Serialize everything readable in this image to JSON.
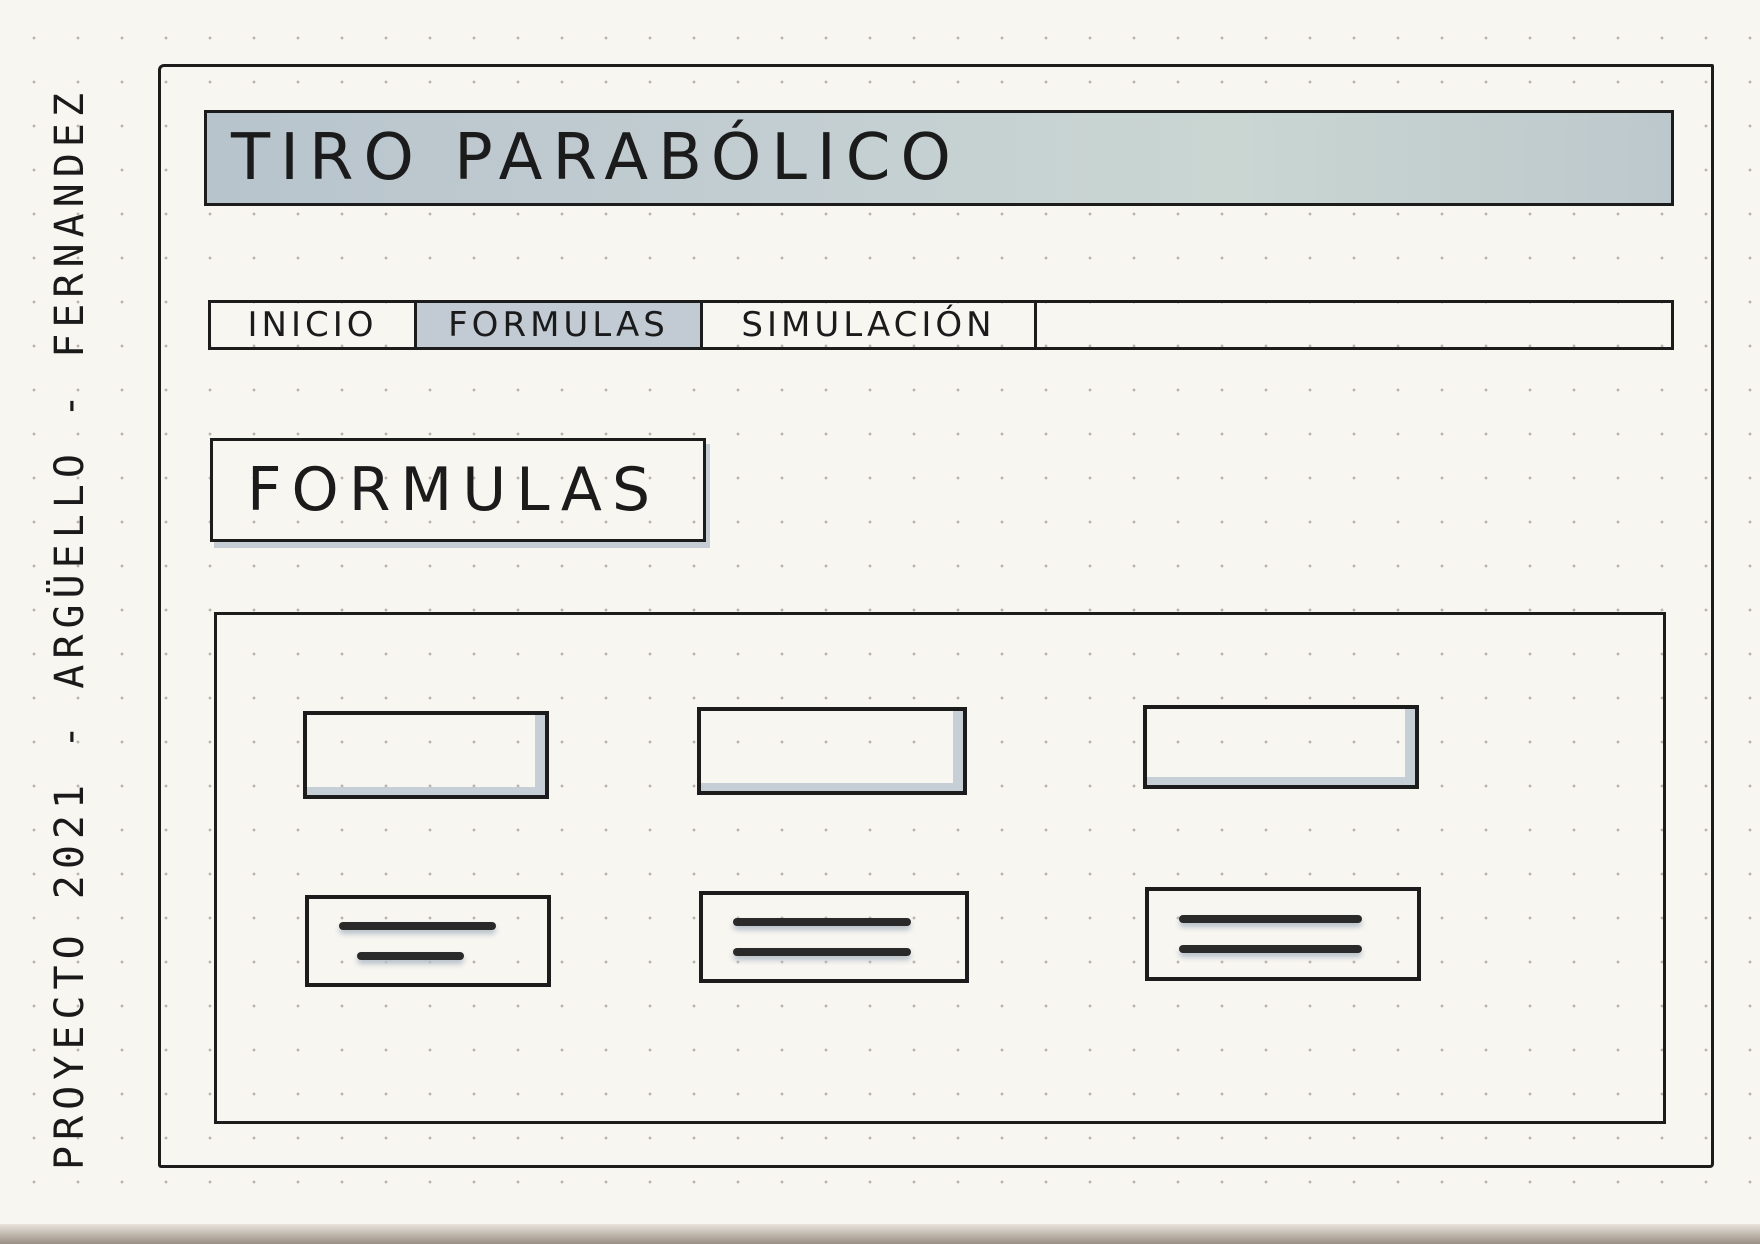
{
  "side_caption": "PROYECTO 2021 - ARGÜELLO - FERNANDEZ",
  "title": "TIRO PARABÓLICO",
  "nav": {
    "tabs": [
      {
        "label": "INICIO"
      },
      {
        "label": "FORMULAS"
      },
      {
        "label": "SIMULACIÓN"
      }
    ]
  },
  "section_heading": "FORMULAS"
}
